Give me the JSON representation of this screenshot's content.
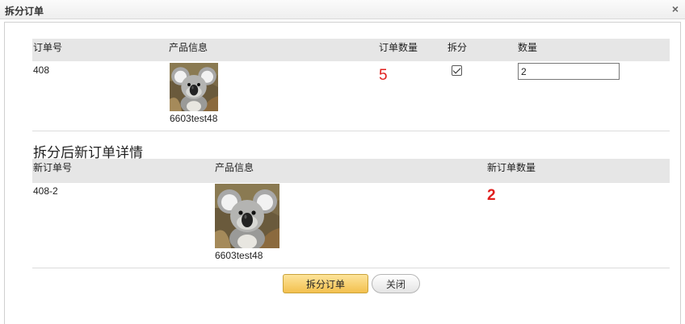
{
  "dialog": {
    "title": "拆分订单",
    "close_symbol": "×"
  },
  "original_table": {
    "headers": {
      "order_no": "订单号",
      "product_info": "产品信息",
      "order_qty": "订单数量",
      "split": "拆分",
      "qty": "数量"
    },
    "row": {
      "order_no": "408",
      "product_name": "6603test48",
      "order_qty": "5",
      "split_checked": true,
      "qty_value": "2"
    }
  },
  "new_section": {
    "title": "拆分后新订单详情",
    "headers": {
      "new_order_no": "新订单号",
      "product_info": "产品信息",
      "new_order_qty": "新订单数量"
    },
    "row": {
      "new_order_no": "408-2",
      "product_name": "6603test48",
      "new_order_qty": "2"
    }
  },
  "buttons": {
    "split": "拆分订单",
    "close": "关闭"
  },
  "colors": {
    "accent_red": "#e0201e",
    "header_bg": "#e6e6e6",
    "primary_button": "#f3c04e"
  },
  "icons": {
    "close": "close-icon",
    "checkbox": "checkbox-checked-icon",
    "product_image": "koala-photo"
  }
}
